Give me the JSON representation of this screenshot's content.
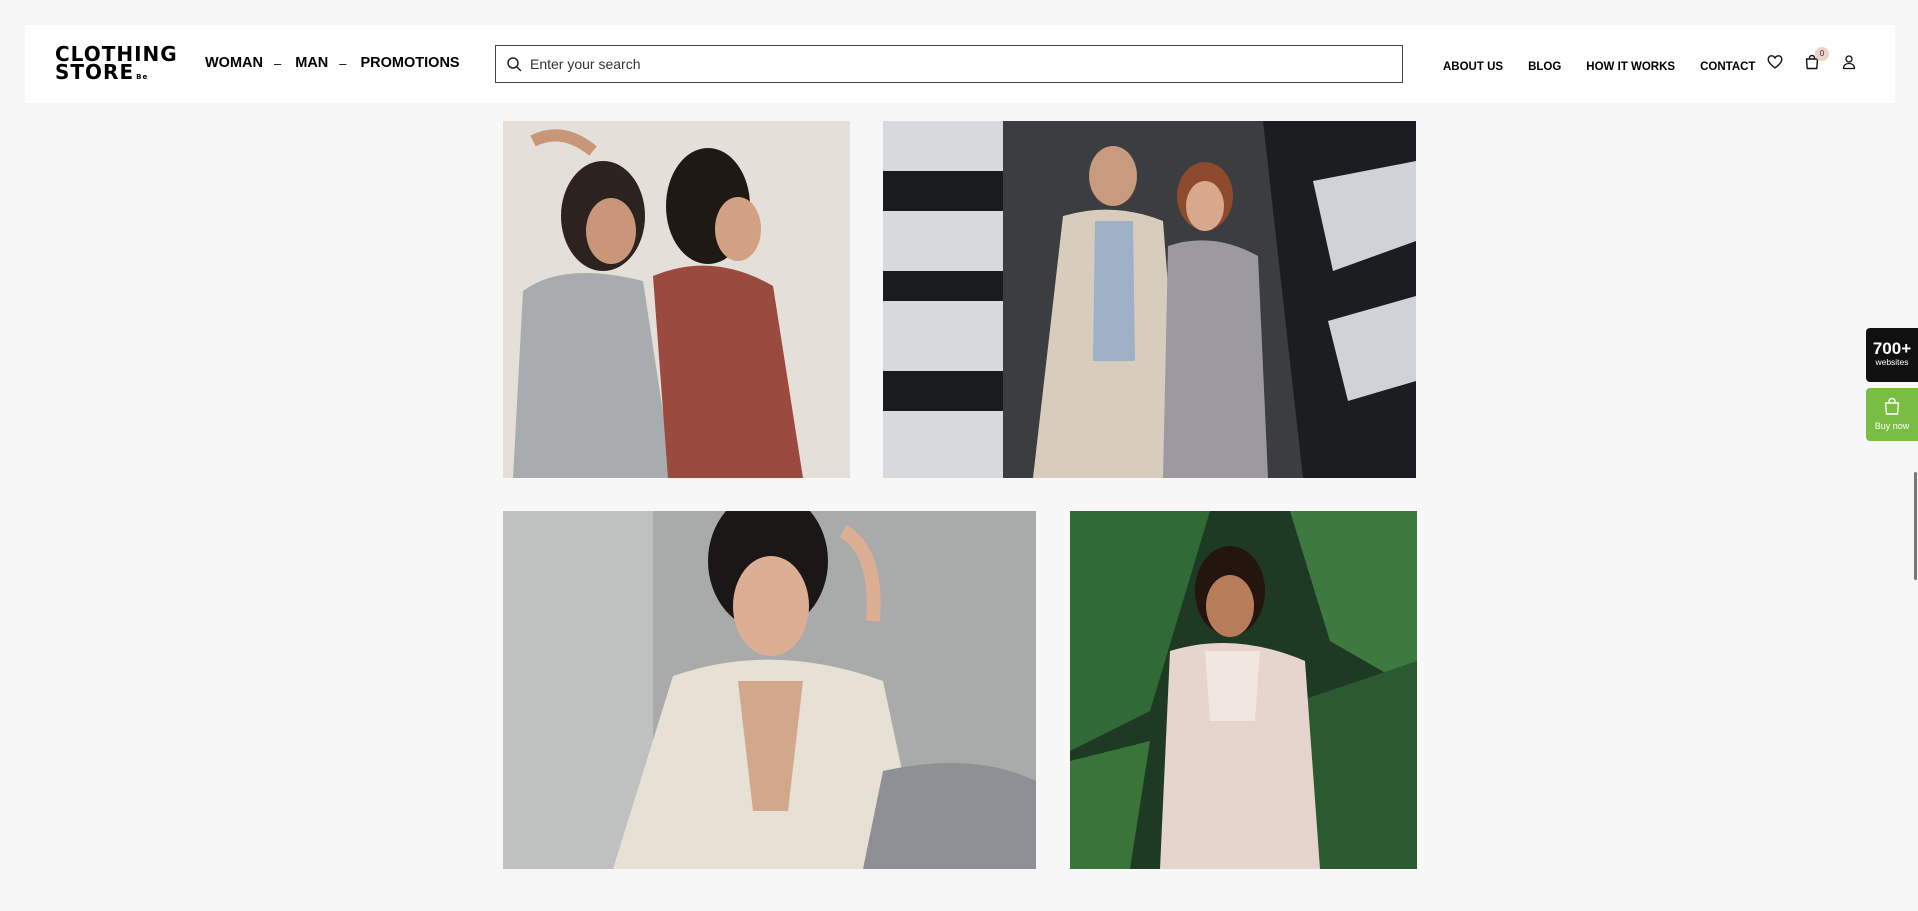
{
  "brand": {
    "line1": "CLOTHING",
    "line2": "STORE",
    "suffix": "Be"
  },
  "main_nav": [
    {
      "label": "WOMAN",
      "has_submenu": true
    },
    {
      "label": "MAN",
      "has_submenu": true
    },
    {
      "label": "PROMOTIONS",
      "has_submenu": false
    }
  ],
  "submenu_marker": "–",
  "search": {
    "placeholder": "Enter your search",
    "value": ""
  },
  "secondary_nav": [
    "ABOUT US",
    "BLOG",
    "HOW IT WORKS",
    "CONTACT"
  ],
  "header_icons": {
    "wishlist": "heart-icon",
    "cart": "shopping-bag-icon",
    "account": "user-icon",
    "cart_count": "0"
  },
  "side_widgets": {
    "websites_count": "700+",
    "websites_label": "websites",
    "buy_label": "Buy now"
  },
  "gallery": [
    {
      "name": "two-women-back-to-back",
      "alt": "two women in grey and red jumpsuits"
    },
    {
      "name": "couple-in-trench-coats",
      "alt": "couple in trench coats by building"
    },
    {
      "name": "woman-white-denim-jacket",
      "alt": "woman in white denim jacket"
    },
    {
      "name": "woman-among-palm-leaves",
      "alt": "woman in cream outfit among palm leaves"
    }
  ],
  "colors": {
    "background": "#f7f7f7",
    "accent_green": "#79bd42",
    "badge": "#e9d3c7",
    "dark_widget": "#101010"
  }
}
